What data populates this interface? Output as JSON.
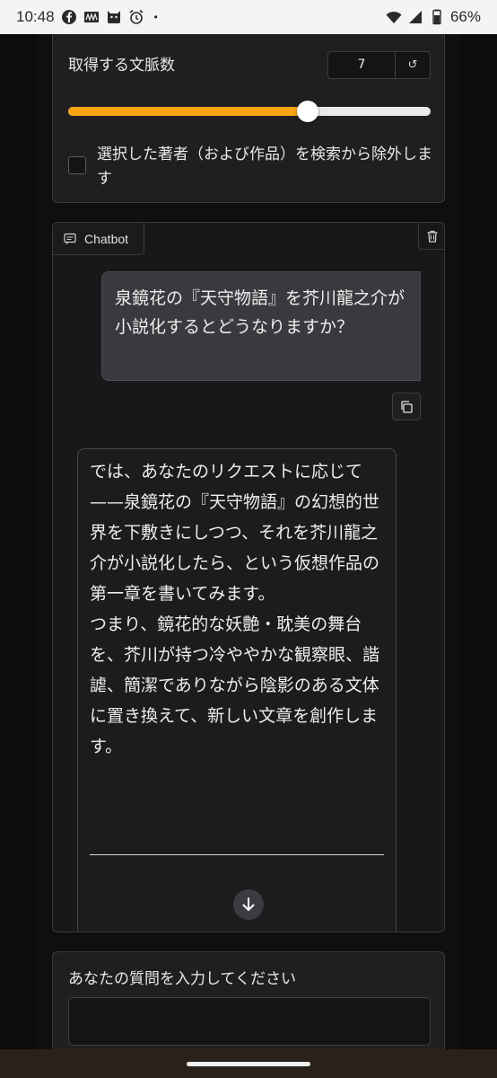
{
  "status_bar": {
    "time": "10:48",
    "battery": "66%",
    "dot": "•"
  },
  "slider_block": {
    "label": "取得する文脈数",
    "value": "7",
    "reset_icon": "↺",
    "slider_fraction": 0.66,
    "checkbox_label": "選択した著者（および作品）を検索から除外します",
    "checked": false
  },
  "chatbot": {
    "label": "Chatbot",
    "user_message": "泉鏡花の『天守物語』を芥川龍之介が小説化するとどうなりますか？",
    "bot_message": "では、あなたのリクエストに応じて——泉鏡花の『天守物語』の幻想的世界を下敷きにしつつ、それを芥川龍之介が小説化したら、という仮想作品の第一章を書いてみます。\nつまり、鏡花的な妖艶・耽美の舞台を、芥川が持つ冷ややかな観察眼、諧謔、簡潔でありながら陰影のある文体に置き換えて、新しい文章を創作します。"
  },
  "question": {
    "label": "あなたの質問を入力してください",
    "value": ""
  },
  "colors": {
    "accent": "#f6a413",
    "background": "#0c0c0d",
    "panel": "#1f1f22"
  }
}
